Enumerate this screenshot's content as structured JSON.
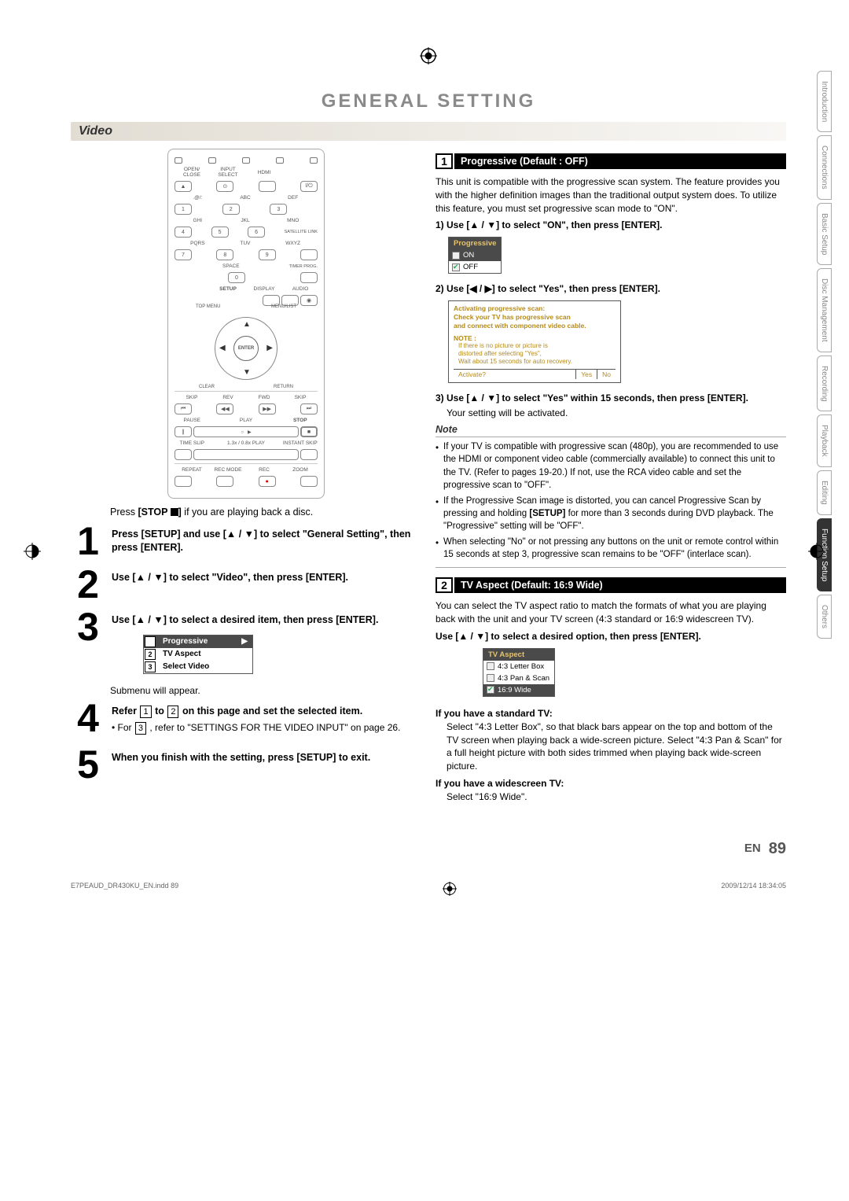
{
  "page": {
    "title": "GENERAL SETTING",
    "section": "Video",
    "page_label": "EN",
    "page_number": "89",
    "footer_left": "E7PEAUD_DR430KU_EN.indd   89",
    "footer_right": "2009/12/14   18:34:05"
  },
  "remote": {
    "top_row": [
      "OPEN/\nCLOSE",
      "INPUT\nSELECT",
      "HDMI",
      ""
    ],
    "power": "I/⏻",
    "numpad": {
      "labels": [
        ".@/:",
        "ABC",
        "DEF",
        "GHI",
        "JKL",
        "MNO",
        "PQRS",
        "TUV",
        "WXYZ",
        "",
        "SPACE",
        ""
      ],
      "digits": [
        "1",
        "2",
        "3",
        "4",
        "5",
        "6",
        "7",
        "8",
        "9",
        "",
        "0",
        ""
      ]
    },
    "side_labels": [
      "SATELLITE LINK",
      "TIMER PROG."
    ],
    "mid_row": [
      "SETUP",
      "DISPLAY",
      "AUDIO"
    ],
    "dpad": {
      "top_menu": "TOP MENU",
      "menu_list": "MENU/LIST",
      "enter": "ENTER",
      "clear": "CLEAR",
      "return": "RETURN"
    },
    "transport": {
      "row1_lbl": [
        "SKIP",
        "REV",
        "FWD",
        "SKIP"
      ],
      "row2_lbl": [
        "PAUSE",
        "PLAY",
        "STOP"
      ],
      "row3_lbl": [
        "TIME SLIP",
        "1.3x / 0.8x PLAY",
        "INSTANT SKIP"
      ],
      "row4_lbl": [
        "REPEAT",
        "REC MODE",
        "REC",
        "ZOOM"
      ]
    }
  },
  "left": {
    "press_stop": "Press [STOP ■] if you are playing back a disc.",
    "step1": "Press [SETUP] and use [▲ / ▼] to select \"General Setting\", then press [ENTER].",
    "step2": "Use [▲ / ▼] to select \"Video\", then press [ENTER].",
    "step3": "Use [▲ / ▼] to select a desired item, then press [ENTER].",
    "submenu": {
      "1": "Progressive",
      "2": "TV Aspect",
      "3": "Select Video"
    },
    "submenu_note": "Submenu will appear.",
    "step4_a": "Refer",
    "step4_b": "to",
    "step4_c": "on this page and set the selected item.",
    "step4_bullet_a": "For",
    "step4_bullet_b": ", refer to \"SETTINGS FOR THE VIDEO INPUT\" on page 26.",
    "step5": "When you finish with the setting, press [SETUP] to exit."
  },
  "right": {
    "banner1": "Progressive (Default : OFF)",
    "intro1": "This unit is compatible with the progressive scan system. The feature provides you with the higher definition images than the traditional output system does. To utilize this feature, you must set progressive scan mode to \"ON\".",
    "sub1": "1) Use [▲ / ▼] to select \"ON\", then press [ENTER].",
    "osd_prog_title": "Progressive",
    "osd_prog_on": "ON",
    "osd_prog_off": "OFF",
    "sub2": "2) Use [◀ / ▶] to select \"Yes\", then press [ENTER].",
    "osd2_l1": "Activating progressive scan:",
    "osd2_l2": "Check your TV has progressive scan",
    "osd2_l3": "and connect with component video cable.",
    "osd2_note": "NOTE :",
    "osd2_n1": "If there is no picture or picture is",
    "osd2_n2": "distorted after selecting \"Yes\",",
    "osd2_n3": "Wait about 15 seconds for auto recovery.",
    "osd2_act": "Activate?",
    "osd2_yes": "Yes",
    "osd2_no": "No",
    "sub3": "3) Use [▲ / ▼] to select \"Yes\" within 15 seconds, then press [ENTER].",
    "sub3_follow": "Your setting will be activated.",
    "note_head": "Note",
    "note1": "If your TV is compatible with progressive scan (480p), you are recommended to use the HDMI or component video cable (commercially available) to connect this unit to the TV. (Refer to pages 19-20.) If not, use the RCA video cable and set the progressive scan to \"OFF\".",
    "note2a": "If the Progressive Scan image is distorted, you can cancel Progressive Scan by pressing and holding ",
    "note2b": "[SETUP]",
    "note2c": " for more than 3 seconds during DVD playback. The \"Progressive\" setting will be \"OFF\".",
    "note3": "When selecting \"No\" or not pressing any buttons on the unit or remote control within 15 seconds at step 3, progressive scan remains to be \"OFF\" (interlace scan).",
    "banner2": "TV Aspect (Default: 16:9 Wide)",
    "intro2": "You can select the TV aspect ratio to match the formats of what you are playing back with the unit and your TV screen (4:3 standard or 16:9 widescreen TV).",
    "sub4": "Use [▲ / ▼] to select a desired option, then press [ENTER].",
    "osd_asp_title": "TV Aspect",
    "osd_asp_1": "4:3 Letter Box",
    "osd_asp_2": "4:3 Pan & Scan",
    "osd_asp_3": "16:9 Wide",
    "std_head": "If you have a standard TV:",
    "std_body": "Select \"4:3 Letter Box\", so that black bars appear on the top and bottom of the TV screen when playing back a wide-screen picture. Select \"4:3 Pan & Scan\" for a full height picture with both sides trimmed when playing back wide-screen picture.",
    "wide_head": "If you have a widescreen TV:",
    "wide_body": "Select \"16:9 Wide\"."
  },
  "tabs": [
    "Introduction",
    "Connections",
    "Basic Setup",
    "Disc Management",
    "Recording",
    "Playback",
    "Editing",
    "Function Setup",
    "Others"
  ],
  "active_tab": "Function Setup"
}
